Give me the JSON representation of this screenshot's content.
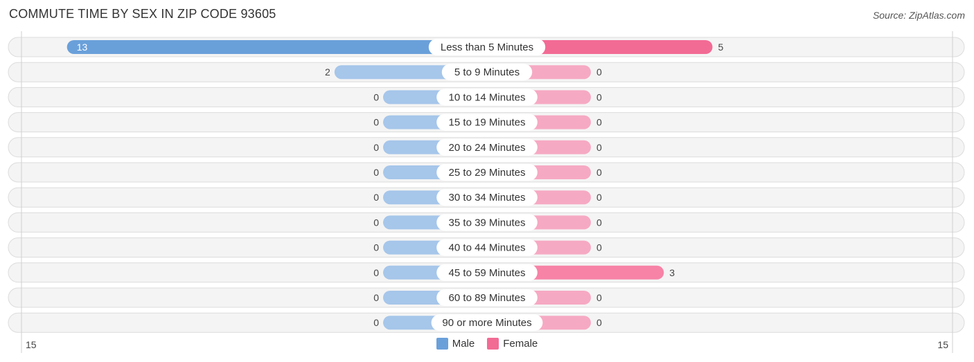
{
  "title": "COMMUTE TIME BY SEX IN ZIP CODE 93605",
  "source": "Source: ZipAtlas.com",
  "chart_data": {
    "type": "bar",
    "orientation": "horizontal-diverging",
    "title": "COMMUTE TIME BY SEX IN ZIP CODE 93605",
    "categories": [
      "Less than 5 Minutes",
      "5 to 9 Minutes",
      "10 to 14 Minutes",
      "15 to 19 Minutes",
      "20 to 24 Minutes",
      "25 to 29 Minutes",
      "30 to 34 Minutes",
      "35 to 39 Minutes",
      "40 to 44 Minutes",
      "45 to 59 Minutes",
      "60 to 89 Minutes",
      "90 or more Minutes"
    ],
    "series": [
      {
        "name": "Male",
        "side": "left",
        "values": [
          13,
          2,
          0,
          0,
          0,
          0,
          0,
          0,
          0,
          0,
          0,
          0
        ]
      },
      {
        "name": "Female",
        "side": "right",
        "values": [
          5,
          0,
          0,
          0,
          0,
          0,
          0,
          0,
          0,
          3,
          0,
          0
        ]
      }
    ],
    "xlim": [
      15,
      15
    ],
    "axis_ticks": {
      "left": "15",
      "right": "15"
    },
    "legend": {
      "position": "bottom-center",
      "entries": [
        "Male",
        "Female"
      ]
    },
    "colors": {
      "male_strong": "#6aa0da",
      "male_light": "#a6c6ea",
      "female_strong": "#f26b95",
      "female_mid": "#f783a7",
      "female_light": "#f6a9c3"
    }
  }
}
